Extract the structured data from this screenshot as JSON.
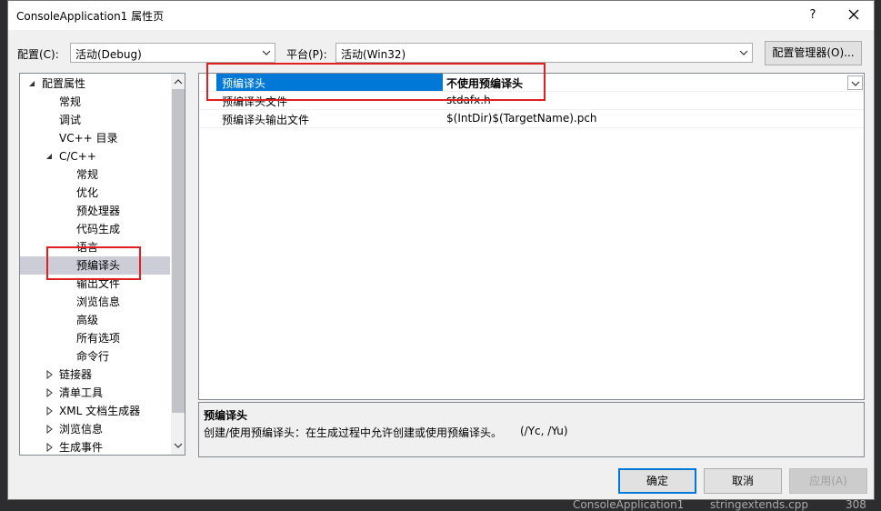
{
  "window": {
    "title": "ConsoleApplication1 属性页",
    "help_glyph": "?"
  },
  "config": {
    "config_label": "配置(C):",
    "config_value": "活动(Debug)",
    "platform_label": "平台(P):",
    "platform_value": "活动(Win32)",
    "manager_button": "配置管理器(O)..."
  },
  "tree": {
    "items": [
      {
        "label": "配置属性",
        "level": 0,
        "expander": "expanded"
      },
      {
        "label": "常规",
        "level": 1,
        "expander": "none"
      },
      {
        "label": "调试",
        "level": 1,
        "expander": "none"
      },
      {
        "label": "VC++ 目录",
        "level": 1,
        "expander": "none"
      },
      {
        "label": "C/C++",
        "level": 1,
        "expander": "expanded"
      },
      {
        "label": "常规",
        "level": 2,
        "expander": "none"
      },
      {
        "label": "优化",
        "level": 2,
        "expander": "none"
      },
      {
        "label": "预处理器",
        "level": 2,
        "expander": "none"
      },
      {
        "label": "代码生成",
        "level": 2,
        "expander": "none"
      },
      {
        "label": "语言",
        "level": 2,
        "expander": "none"
      },
      {
        "label": "预编译头",
        "level": 2,
        "expander": "none",
        "selected": true
      },
      {
        "label": "输出文件",
        "level": 2,
        "expander": "none"
      },
      {
        "label": "浏览信息",
        "level": 2,
        "expander": "none"
      },
      {
        "label": "高级",
        "level": 2,
        "expander": "none"
      },
      {
        "label": "所有选项",
        "level": 2,
        "expander": "none"
      },
      {
        "label": "命令行",
        "level": 2,
        "expander": "none"
      },
      {
        "label": "链接器",
        "level": 1,
        "expander": "collapsed"
      },
      {
        "label": "清单工具",
        "level": 1,
        "expander": "collapsed"
      },
      {
        "label": "XML 文档生成器",
        "level": 1,
        "expander": "collapsed"
      },
      {
        "label": "浏览信息",
        "level": 1,
        "expander": "collapsed"
      },
      {
        "label": "生成事件",
        "level": 1,
        "expander": "collapsed"
      }
    ]
  },
  "grid": {
    "rows": [
      {
        "name": "预编译头",
        "value": "不使用预编译头",
        "selected": true
      },
      {
        "name": "预编译头文件",
        "value": "stdafx.h"
      },
      {
        "name": "预编译头输出文件",
        "value": "$(IntDir)$(TargetName).pch"
      }
    ]
  },
  "description": {
    "title": "预编译头",
    "text": "创建/使用预编译头：在生成过程中允许创建或使用预编译头。",
    "switches": "(/Yc, /Yu)"
  },
  "buttons": {
    "ok": "确定",
    "cancel": "取消",
    "apply": "应用(A)"
  },
  "background": {
    "project_label": "ConsoleApplication1",
    "file_label": "stringextends.cpp",
    "number": "308"
  },
  "colors": {
    "accent": "#0078d7",
    "highlight_box": "#e02020",
    "tree_selection": "#cdcdd8"
  }
}
